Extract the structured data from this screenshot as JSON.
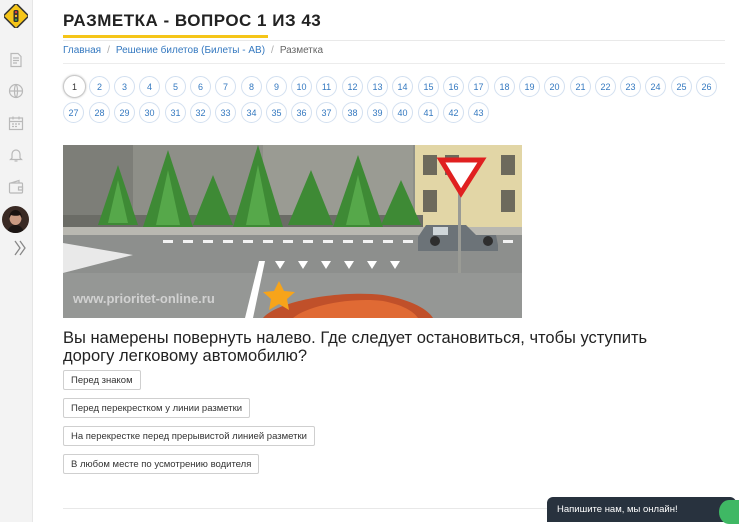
{
  "page": {
    "title": "РАЗМЕТКА - ВОПРОС 1 ИЗ 43"
  },
  "breadcrumb": {
    "home": "Главная",
    "tickets": "Решение билетов (Билеты - АВ)",
    "current": "Разметка"
  },
  "questions": {
    "numbers": [
      "1",
      "2",
      "3",
      "4",
      "5",
      "6",
      "7",
      "8",
      "9",
      "10",
      "11",
      "12",
      "13",
      "14",
      "15",
      "16",
      "17",
      "18",
      "19",
      "20",
      "21",
      "22",
      "23",
      "24",
      "25",
      "26",
      "27",
      "28",
      "29",
      "30",
      "31",
      "32",
      "33",
      "34",
      "35",
      "36",
      "37",
      "38",
      "39",
      "40",
      "41",
      "42",
      "43"
    ],
    "current": "1"
  },
  "image": {
    "watermark": "www.prioritet-online.ru"
  },
  "question_text": "Вы намерены повернуть налево. Где следует остановиться, чтобы уступить дорогу легковому автомобилю?",
  "answers": [
    "Перед знаком",
    "Перед перекрестком у линии разметки",
    "На перекрестке перед прерывистой линией разметки",
    "В любом месте по усмотрению водителя"
  ],
  "chat": {
    "label": "Напишите нам, мы онлайн!"
  },
  "sidebar": {
    "icons": [
      "traffic-light-logo-icon",
      "document-icon",
      "globe-icon",
      "calendar-icon",
      "bell-icon",
      "wallet-icon",
      "avatar",
      "double-chevron-right-icon"
    ]
  },
  "colors": {
    "accent": "#f5c518",
    "link": "#3579c0",
    "chat_bg": "#28323e",
    "chat_dot": "#3fb864"
  }
}
